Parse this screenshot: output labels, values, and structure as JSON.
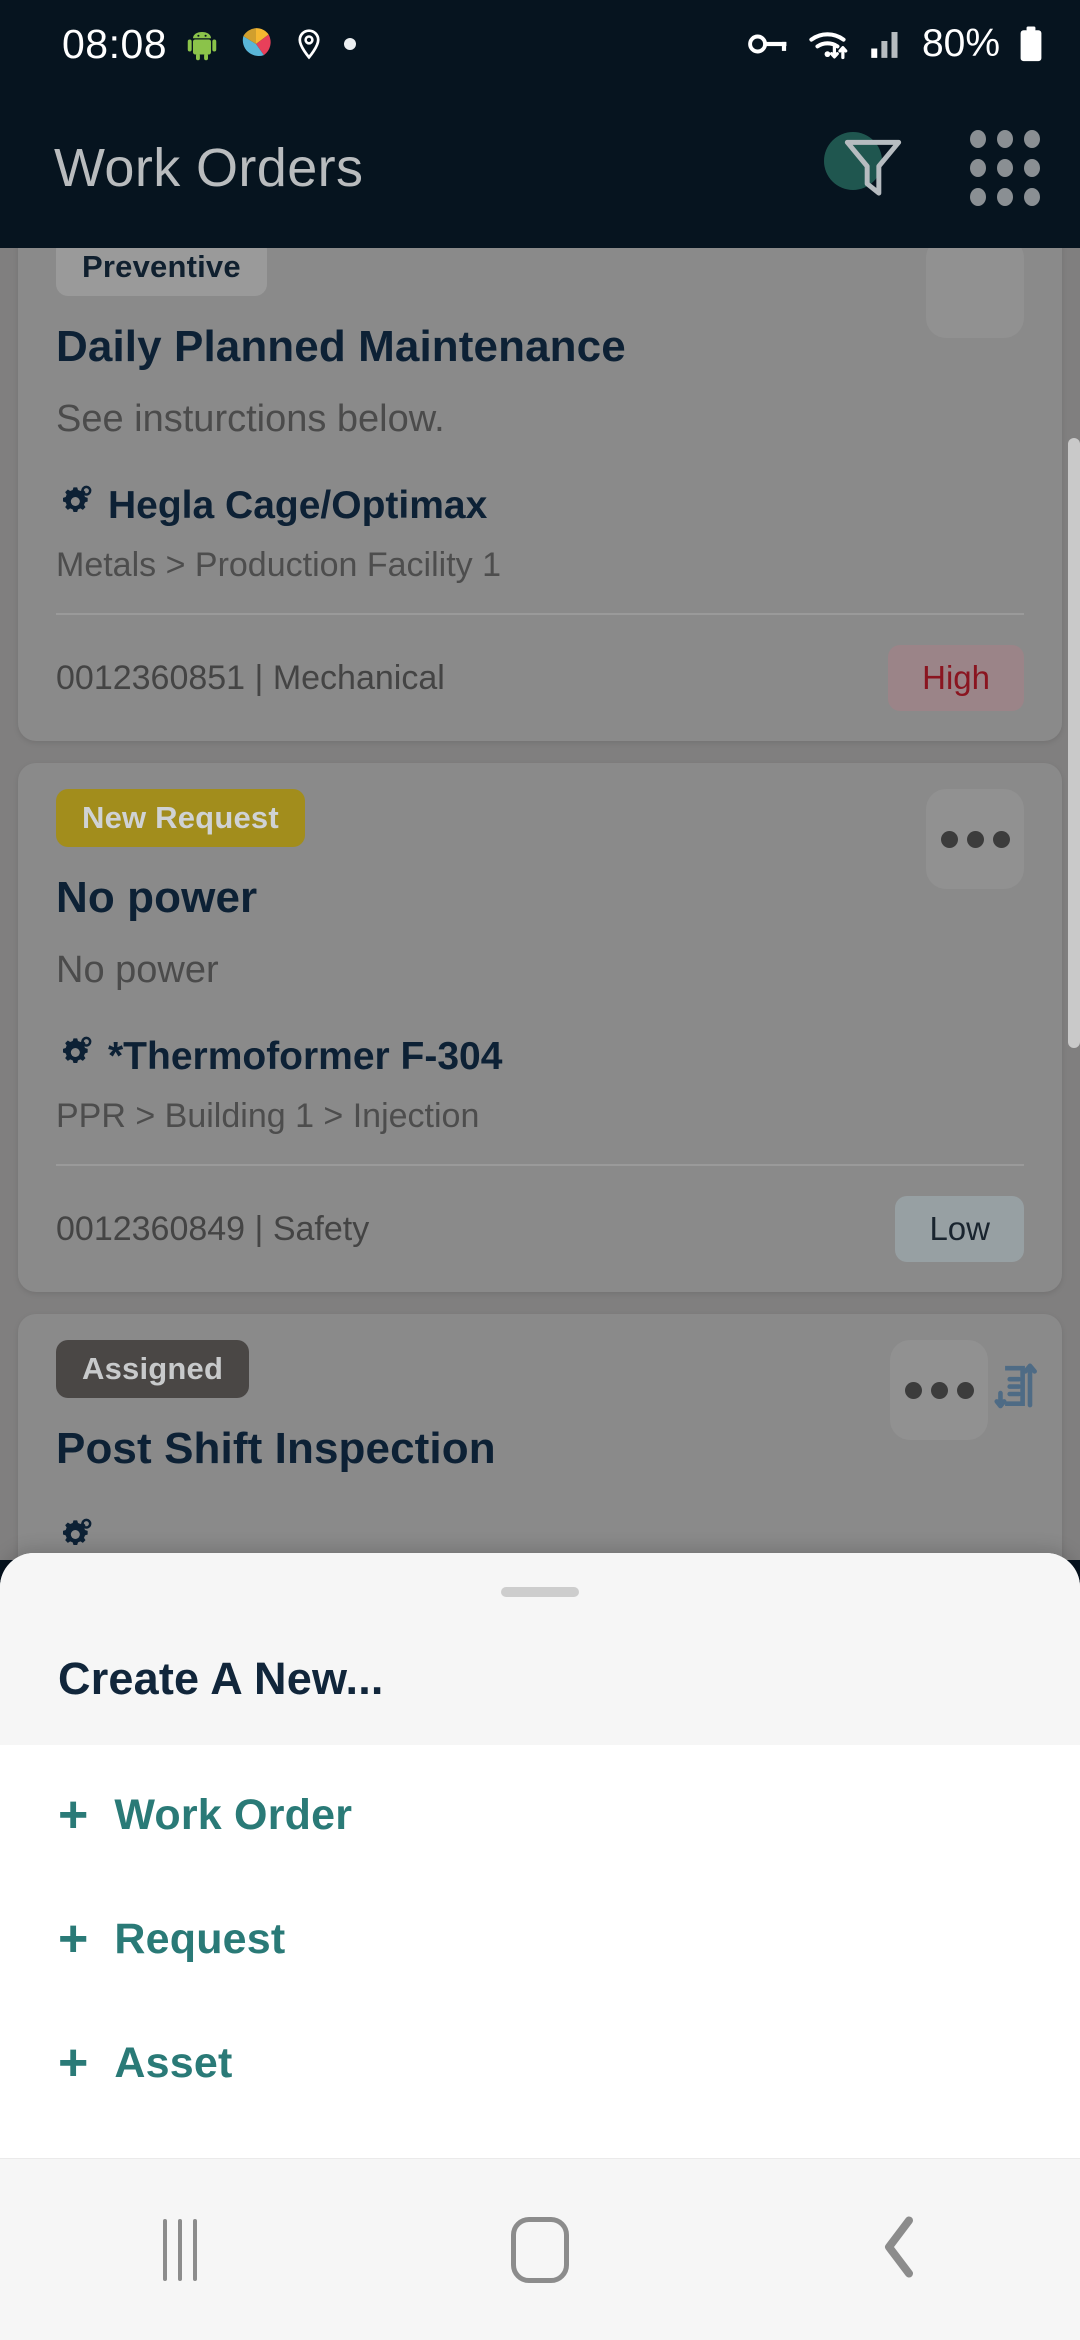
{
  "status_bar": {
    "time": "08:08",
    "battery_percent": "80%",
    "left_icons": [
      "android-robot-icon",
      "camera-app-icon",
      "location-pin-icon",
      "dot-indicator-icon"
    ],
    "right_icons": [
      "vpn-key-icon",
      "wifi-icon",
      "cellular-signal-icon",
      "battery-icon"
    ]
  },
  "header": {
    "title": "Work Orders",
    "filter_icon": "filter-funnel-icon",
    "filter_badge_color": "#1f564f",
    "grid_icon": "apps-grid-icon"
  },
  "work_orders": [
    {
      "status": "Preventive",
      "status_type": "preventive",
      "title": "Daily Planned Maintenance",
      "description": "See insturctions below.",
      "asset": "Hegla Cage/Optimax",
      "location": "Metals > Production Facility 1",
      "work_order_meta": "0012360851 | Mechanical",
      "priority": "High",
      "priority_type": "high",
      "side_icon": "checklist-download-icon"
    },
    {
      "status": "New Request",
      "status_type": "newrequest",
      "title": "No power",
      "description": "No power",
      "asset": "*Thermoformer F-304",
      "location": "PPR > Building 1 > Injection",
      "work_order_meta": "0012360849 | Safety",
      "priority": "Low",
      "priority_type": "low",
      "side_icon": "none"
    },
    {
      "status": "Assigned",
      "status_type": "assigned",
      "title": "Post Shift Inspection",
      "description": "",
      "asset": "",
      "location": "",
      "work_order_meta": "",
      "priority": "",
      "priority_type": "",
      "side_icon": "document-sort-icon"
    }
  ],
  "bottom_sheet": {
    "title": "Create A New...",
    "accent_color": "#2a7a77",
    "items": [
      {
        "label": "Work Order",
        "icon": "plus-icon"
      },
      {
        "label": "Request",
        "icon": "plus-icon"
      },
      {
        "label": "Asset",
        "icon": "plus-icon"
      }
    ]
  },
  "nav_bar": {
    "recents_icon": "recents-icon",
    "home_icon": "home-icon",
    "back_icon": "back-chevron-icon"
  }
}
